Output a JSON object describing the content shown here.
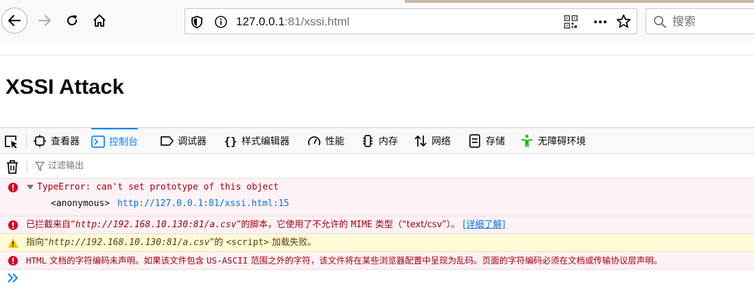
{
  "browser": {
    "url_host": "127.0.0.1",
    "url_rest": ":81/xssi.html",
    "search_placeholder": "搜索",
    "icons": [
      "back-arrow-icon",
      "forward-arrow-icon",
      "reload-icon",
      "home-icon",
      "shield-icon",
      "info-icon",
      "qr-code-icon",
      "more-dots-icon",
      "bookmark-star-icon",
      "search-icon"
    ]
  },
  "page": {
    "heading": "XSSI Attack"
  },
  "devtools": {
    "tabs": [
      {
        "label": "查看器",
        "icon": "inspector-icon"
      },
      {
        "label": "控制台",
        "icon": "console-icon",
        "active": true
      },
      {
        "label": "调试器",
        "icon": "debugger-icon"
      },
      {
        "label": "样式编辑器",
        "icon": "braces-icon"
      },
      {
        "label": "性能",
        "icon": "performance-icon"
      },
      {
        "label": "内存",
        "icon": "memory-icon"
      },
      {
        "label": "网络",
        "icon": "network-arrows-icon"
      },
      {
        "label": "存储",
        "icon": "storage-icon"
      },
      {
        "label": "无障碍环境",
        "icon": "accessibility-icon"
      }
    ],
    "filter_placeholder": "过滤输出",
    "messages": {
      "m1": {
        "text": "TypeError: can't set prototype of this object",
        "frame_fn": "<anonymous>",
        "frame_url": "http://127.0.0.1:81/xssi.html:15"
      },
      "m2": {
        "pre": "已拦截来自“",
        "url": "http://192.168.10.130:81/a.csv",
        "mid": "”的脚本，它使用了不允许的 ",
        "mime": "MIME",
        "post": " 类型（“text/csv”）。",
        "learn_more": "[详细了解]"
      },
      "m3": {
        "pre": "指向“",
        "url": "http://192.168.10.130:81/a.csv",
        "mid": "”的 ",
        "tag": "<script>",
        "post": " 加载失败。"
      },
      "m4": {
        "html": "HTML",
        "mid": " 文档的字符编码未声明。如果该文件包含 ",
        "ascii": "US-ASCII",
        "post": " 范围之外的字符，该文件将在某些浏览器配置中呈现为乱码。页面的字符编码必须在文档或传输协议层声明。"
      }
    },
    "colors": {
      "error": "#d70022",
      "warning": "#ffbf00",
      "accent": "#0a84ff"
    }
  }
}
